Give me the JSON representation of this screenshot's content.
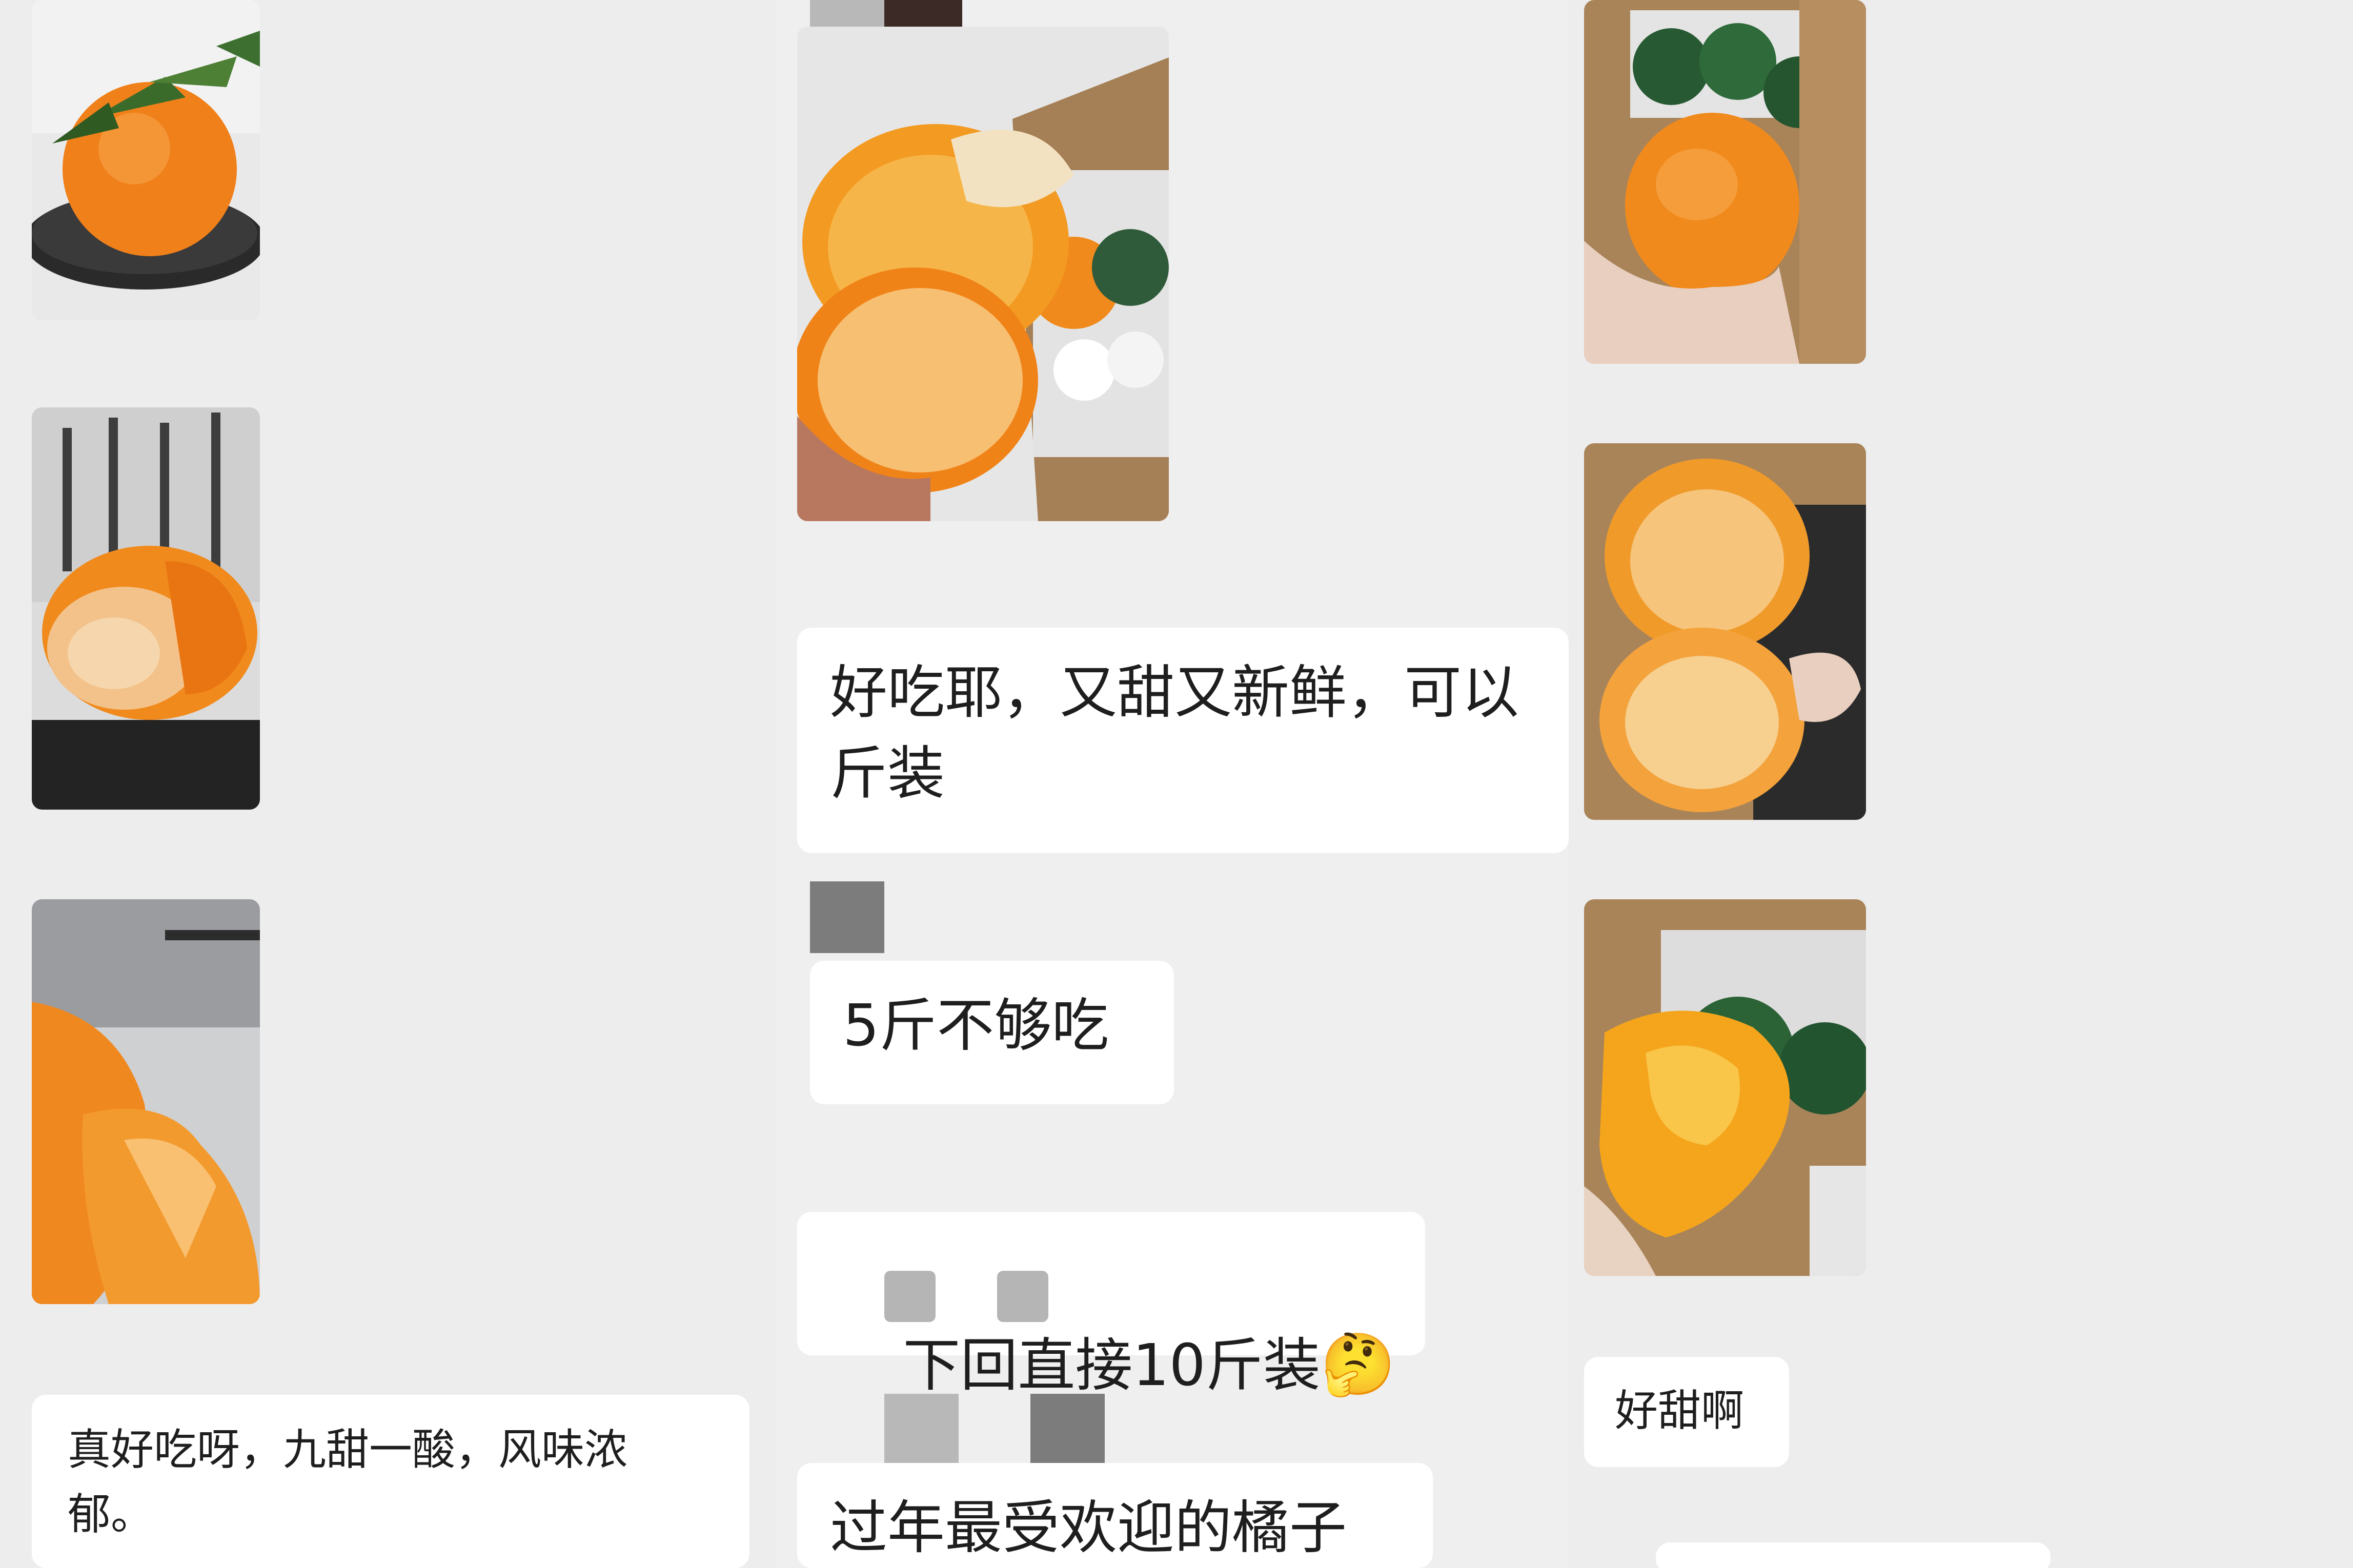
{
  "messages": {
    "left_review": "真好吃呀，九甜一酸，风味浓\n郁。",
    "mid_review": "好吃耶，又甜又新鲜，可以\n斤装",
    "mid_not_enough": "5斤不够吃",
    "mid_next_time": "下回直接10斤装",
    "mid_new_year": "过年最受欢迎的橘子",
    "right_sweet": "好甜啊"
  },
  "icons": {
    "thinking_emoji": "🤔"
  },
  "colors": {
    "chat_background": "#ededed",
    "bubble": "#ffffff",
    "text": "#1e1e1e",
    "orange": "#f08a1c"
  }
}
